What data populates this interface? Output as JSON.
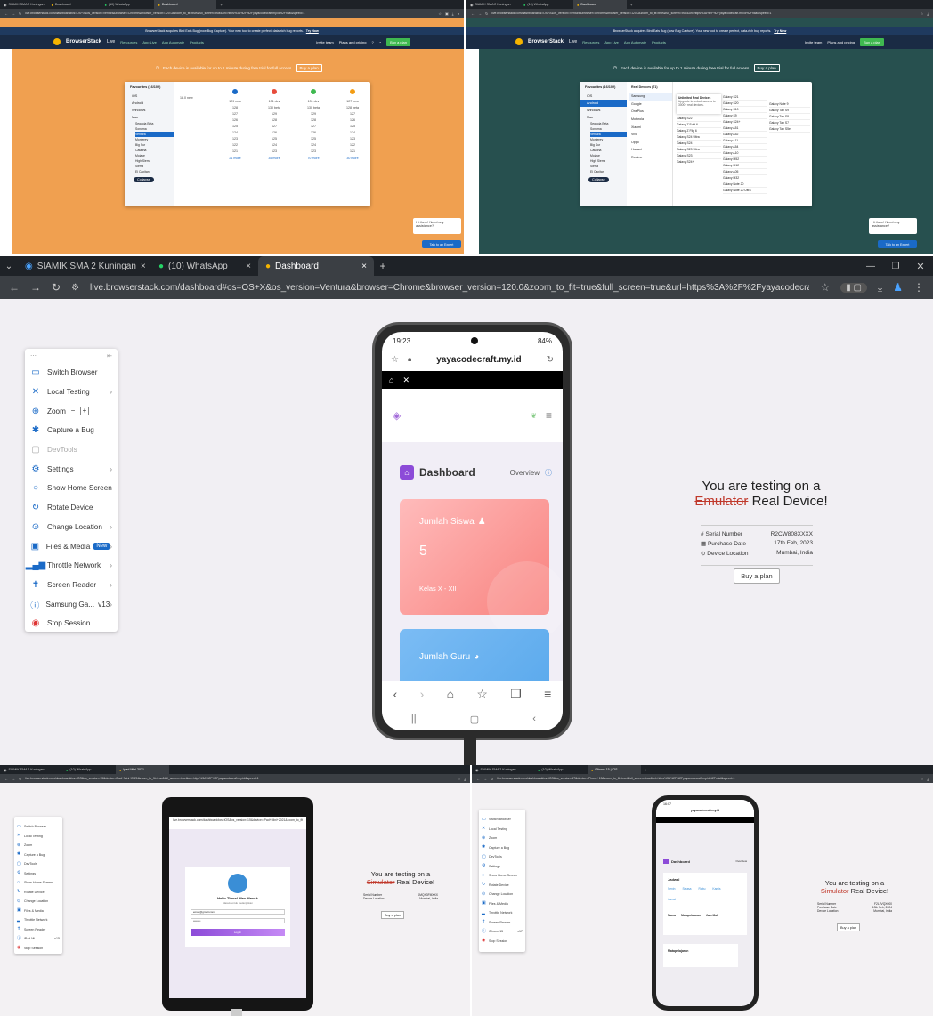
{
  "tl": {
    "tabs": [
      "SIAMIK SMA 2 Kuningan",
      "Dashboard",
      "(10) WhatsApp",
      "Dashboard"
    ],
    "url": "live.browserstack.com/dashboard#os=OS+X&os_version=Ventura&browser=Chrome&browser_version=120.0&zoom_to_fit=true&full_screen=true&url=https%3A%2F%2Fyayacodecraft.my.id%2Fnilai&speed=1",
    "banner": "BrowserStack acquires Bird Eats Bug (now Bug Capture). Your new tool to create perfect, data-rich bug reports.",
    "banner_link": "Try Now",
    "brand": "BrowserStack",
    "brand_sub": "Live",
    "nav": [
      "Resources",
      "App Live",
      "App Automate",
      "Products"
    ],
    "actions": [
      "Invite team",
      "Plans and pricing"
    ],
    "buy": "Buy a plan",
    "notice": "Each device is available for up to 1 minute during free trial for full access.",
    "notice_btn": "Buy a plan",
    "os_header": "Favourites (16/102)",
    "os_list": [
      "iOS",
      "Android",
      "Windows",
      "Mac"
    ],
    "mac_versions": [
      "Sequoia Beta",
      "Sonoma",
      "Ventura",
      "Monterey",
      "Big Sur",
      "Catalina",
      "Mojave",
      "High Sierra",
      "Sierra",
      "El Capitan"
    ],
    "collapse": "Collapse",
    "first_col": "18.0 new",
    "browsers_cols": [
      [
        "129 new",
        "128",
        "127",
        "126",
        "125",
        "124",
        "123",
        "122",
        "121"
      ],
      [
        "131 dev",
        "130 beta",
        "129",
        "128",
        "127",
        "126",
        "125",
        "124",
        "123"
      ],
      [
        "131 dev",
        "130 beta",
        "129",
        "128",
        "127",
        "126",
        "125",
        "124",
        "123"
      ],
      [
        "127 new",
        "128 beta",
        "127",
        "126",
        "125",
        "124",
        "123",
        "122",
        "121"
      ]
    ],
    "more": [
      "21 more",
      "35 more",
      "70 more",
      "30 more"
    ],
    "chat": "Hi there! Need any assistance?",
    "talk": "Talk to an Expert"
  },
  "tr": {
    "tabs": [
      "SIAMIK SMA 2 Kuningan",
      "(10) WhatsApp",
      "Dashboard"
    ],
    "url": "live.browserstack.com/dashboard#os=OS+X&os_version=Ventura&browser=Chrome&browser_version=120.0&zoom_to_fit=true&full_screen=true&url=https%3A%2F%2Fyayacodecraft.my.id%2Fnilai&speed=1",
    "banner": "BrowserStack acquires Bird Eats Bug (now Bug Capture). Your new tool to create perfect, data-rich bug reports.",
    "banner_link": "Try Now",
    "notice": "Each device is available for up to 1 minute during free trial for full access.",
    "notice_btn": "Buy a plan",
    "os_header": "Favourites (16/102)",
    "os_list": [
      "iOS",
      "Android",
      "Windows",
      "Mac"
    ],
    "mac_versions": [
      "Sequoia Beta",
      "Sonoma",
      "Ventura",
      "Monterey",
      "Big Sur",
      "Catalina",
      "Mojave",
      "High Sierra",
      "Sierra",
      "El Capitan"
    ],
    "real_header": "Real Devices (71)",
    "brands": [
      "Samsung",
      "Google",
      "OnePlus",
      "Motorola",
      "Xiaomi",
      "Vivo",
      "Oppo",
      "Huawei",
      "Realme"
    ],
    "popup_title": "Unlimited Real Devices",
    "popup_body": "Upgrade to unlock access to 3000+ real devices.",
    "col1": [
      "Galaxy S22",
      "Galaxy Z Fold 6",
      "Galaxy Z Flip 6",
      "Galaxy S24 Ultra",
      "Galaxy S24",
      "Galaxy S23 Ultra",
      "Galaxy S23",
      "Galaxy S24+"
    ],
    "col2": [
      "Galaxy S21",
      "Galaxy S20",
      "Galaxy S10",
      "Galaxy S9",
      "Galaxy S24+",
      "Galaxy A51",
      "Galaxy A52",
      "Galaxy A11",
      "Galaxy A54",
      "Galaxy A10",
      "Galaxy M52",
      "Galaxy M12",
      "Galaxy A05",
      "Galaxy M32",
      "Galaxy Note 20",
      "Galaxy Note 20 Ultra"
    ],
    "col3": [
      "Galaxy Note 9",
      "Galaxy Tab S9",
      "Galaxy Tab S8",
      "Galaxy Tab S7",
      "Galaxy Tab S5e"
    ],
    "collapse": "Collapse",
    "chat": "Hi there! Need any assistance?",
    "talk": "Talk to an Expert"
  },
  "big": {
    "tabs": [
      "SIAMIK SMA 2 Kuningan",
      "(10) WhatsApp",
      "Dashboard"
    ],
    "url": "live.browserstack.com/dashboard#os=OS+X&os_version=Ventura&browser=Chrome&browser_version=120.0&zoom_to_fit=true&full_screen=true&url=https%3A%2F%2Fyayacodecraft.my.id%2Fnilai&speed=1",
    "menu": {
      "switch": "Switch Browser",
      "local": "Local Testing",
      "zoom": "Zoom",
      "zoom_minus": "−",
      "zoom_plus": "+",
      "capture": "Capture a Bug",
      "devtools": "DevTools",
      "settings": "Settings",
      "home": "Show Home Screen",
      "rotate": "Rotate Device",
      "location": "Change Location",
      "files": "Files & Media",
      "files_badge": "New",
      "throttle": "Throttle Network",
      "reader": "Screen Reader",
      "device": "Samsung Ga...",
      "device_version": "v13",
      "stop": "Stop Session"
    },
    "phone": {
      "time": "19:23",
      "battery": "84%",
      "domain": "yayacodecraft.my.id",
      "dashboard": "Dashboard",
      "overview": "Overview",
      "card1_title": "Jumlah Siswa",
      "card1_value": "5",
      "card1_sub": "Kelas X - XII",
      "card2_title": "Jumlah Guru"
    },
    "testing_line1": "You are testing on a",
    "testing_strike": "Emulator",
    "testing_rest": "Real Device!",
    "info": [
      {
        "label": "Serial Number",
        "value": "R2CW808XXXX"
      },
      {
        "label": "Purchase Date",
        "value": "17th Feb, 2023"
      },
      {
        "label": "Device Location",
        "value": "Mumbai, India"
      }
    ],
    "buy": "Buy a plan"
  },
  "bl": {
    "tabs": [
      "SIAMIK SMA 2 Kuningan",
      "(10) WhatsApp",
      "Ipad Mini 2021"
    ],
    "url": "live.browserstack.com/dashboard#os=iOS&os_version=15&device=iPad+Mini+2021&zoom_to_fit=true&full_screen=true&url=https%3A%2F%2Fyayacodecraft.my.id&speed=1",
    "menu": [
      "Switch Browser",
      "Local Testing",
      "Zoom",
      "Capture a Bug",
      "DevTools",
      "Settings",
      "Show Home Screen",
      "Rotate Device",
      "Change Location",
      "Files & Media",
      "Throttle Network",
      "Screen Reader",
      "iPad Mi",
      "Stop Session"
    ],
    "version": "v15",
    "login_title": "Hello There! Mau Masuk",
    "login_sub": "Masuk untuk melanjutkan",
    "email": "email@gmail.com",
    "pass": "••••••••",
    "login_btn": "Log In",
    "testing_line1": "You are testing on a",
    "testing_strike": "Simulator",
    "testing_rest": "Real Device!",
    "info": [
      {
        "label": "Serial Number",
        "value": "DMQX3FMXXX"
      },
      {
        "label": "Device Location",
        "value": "Mumbai, India"
      }
    ],
    "buy": "Buy a plan"
  },
  "br": {
    "tabs": [
      "SIAMIK SMA 2 Kuningan",
      "(10) WhatsApp",
      "iPhone 15 | iOS"
    ],
    "url": "live.browserstack.com/dashboard#os=iOS&os_version=17&device=iPhone+15&zoom_to_fit=true&full_screen=true&url=https%3A%2F%2Fyayacodecraft.my.id%2Fnilai&speed=1",
    "menu": [
      "Switch Browser",
      "Local Testing",
      "Zoom",
      "Capture a Bug",
      "DevTools",
      "Settings",
      "Show Home Screen",
      "Rotate Device",
      "Change Location",
      "Files & Media",
      "Throttle Network",
      "Screen Reader",
      "iPhone 15",
      "Stop Session"
    ],
    "version": "v17",
    "time": "16:07",
    "domain": "yayacodecraft.my.id",
    "dashboard": "Dashboard",
    "overview": "Overview",
    "jadwal": "Jadwal",
    "days": [
      "Senin",
      "Selasa",
      "Rabu",
      "Kamis",
      "Jumat"
    ],
    "cols": [
      "Nama",
      "Matapelajaran",
      "Jam Mul"
    ],
    "mapel": "Matapelajaran",
    "testing_line1": "You are testing on a",
    "testing_strike": "Simulator",
    "testing_rest": "Real Device!",
    "info": [
      {
        "label": "Serial Number",
        "value": "F2L2VQX000"
      },
      {
        "label": "Purchase Date",
        "value": "13th Feb, 2024"
      },
      {
        "label": "Device Location",
        "value": "Mumbai, India"
      }
    ],
    "buy": "Buy a plan"
  },
  "colors": {
    "chrome_dark": "#1e2227",
    "chrome_bar": "#3b3f44",
    "accent": "#1a6ac7",
    "bs_header": "#1a2b44",
    "buy_green": "#3fb950",
    "card_pink": "#f8827e",
    "card_blue": "#5aa9ec",
    "purple": "#8c4bd8"
  }
}
